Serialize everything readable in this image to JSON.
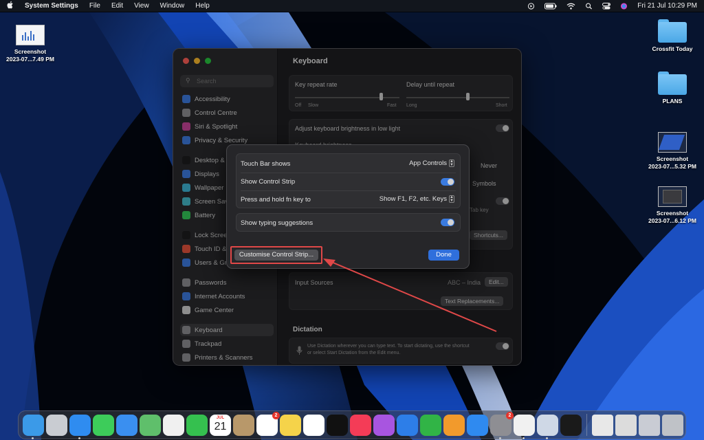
{
  "menubar": {
    "apple_icon": "apple-logo-icon",
    "app_name": "System Settings",
    "menus": [
      "File",
      "Edit",
      "View",
      "Window",
      "Help"
    ],
    "status_icons": [
      "screen-record-icon",
      "battery-icon",
      "wifi-icon",
      "spotlight-search-icon",
      "control-centre-icon",
      "siri-icon"
    ],
    "clock": "Fri 21 Jul  10:29 PM"
  },
  "desktop": {
    "items": [
      {
        "name": "Screenshot",
        "sub": "2023-07...7.49 PM",
        "type": "screenshot"
      },
      {
        "name": "Crossfit Today",
        "sub": "",
        "type": "folder"
      },
      {
        "name": "PLANS",
        "sub": "",
        "type": "folder"
      },
      {
        "name": "Screenshot",
        "sub": "2023-07...5.32 PM",
        "type": "screenshot"
      },
      {
        "name": "Screenshot",
        "sub": "2023-07...6.12 PM",
        "type": "screenshot"
      }
    ]
  },
  "window": {
    "search_placeholder": "Search",
    "sidebar": [
      {
        "label": "Accessibility",
        "color": "#3d7be0"
      },
      {
        "label": "Control Centre",
        "color": "#8e8e93"
      },
      {
        "label": "Siri & Spotlight",
        "color": "#c8459a"
      },
      {
        "label": "Privacy & Security",
        "color": "#3d7be0"
      },
      {
        "label": "Desktop & Dock",
        "color": "#1c1c1e"
      },
      {
        "label": "Displays",
        "color": "#3d7be0"
      },
      {
        "label": "Wallpaper",
        "color": "#3fb4d4"
      },
      {
        "label": "Screen Saver",
        "color": "#45b8c9"
      },
      {
        "label": "Battery",
        "color": "#34c759"
      },
      {
        "label": "Lock Screen",
        "color": "#1c1c1e"
      },
      {
        "label": "Touch ID & Password",
        "color": "#e5533d"
      },
      {
        "label": "Users & Groups",
        "color": "#3d7be0"
      },
      {
        "label": "Passwords",
        "color": "#8e8e93"
      },
      {
        "label": "Internet Accounts",
        "color": "#3d7be0"
      },
      {
        "label": "Game Center",
        "color": "#d0d0d0"
      },
      {
        "label": "Keyboard",
        "color": "#8e8e93"
      },
      {
        "label": "Trackpad",
        "color": "#8e8e93"
      },
      {
        "label": "Printers & Scanners",
        "color": "#8e8e93"
      }
    ],
    "title": "Keyboard",
    "key_repeat_rate_label": "Key repeat rate",
    "key_repeat_left": "Off",
    "key_repeat_slow": "Slow",
    "key_repeat_fast": "Fast",
    "delay_label": "Delay until repeat",
    "delay_long": "Long",
    "delay_short": "Short",
    "brightness_label": "Adjust keyboard brightness in low light",
    "brightness_label_partial": "Keyboard brightness",
    "never_value": "Never",
    "symbols_value": "Symbols",
    "tab_key_partial": "Tab key",
    "shortcuts_btn": "Shortcuts...",
    "input_sources_label": "Input Sources",
    "input_sources_value": "ABC – India",
    "edit_btn": "Edit...",
    "text_replacements_btn": "Text Replacements...",
    "dictation_title": "Dictation",
    "dictation_desc_1": "Use Dictation wherever you can type text. To start dictating, use the shortcut",
    "dictation_desc_2": "or select Start Dictation from the Edit menu.",
    "dictation_on": false
  },
  "sheet": {
    "touch_bar_label": "Touch Bar shows",
    "touch_bar_value": "App Controls",
    "control_strip_label": "Show Control Strip",
    "control_strip_on": true,
    "fn_key_label": "Press and hold fn key to",
    "fn_key_value": "Show F1, F2, etc. Keys",
    "typing_label": "Show typing suggestions",
    "typing_on": true,
    "customise_btn": "Customise Control Strip...",
    "done_btn": "Done"
  },
  "annotation": {
    "color": "#e04848"
  },
  "dock": {
    "apps": [
      {
        "name": "finder-icon",
        "color": "#3b9ae8",
        "running": true
      },
      {
        "name": "launchpad-icon",
        "color": "#c9ccd2",
        "running": false
      },
      {
        "name": "safari-icon",
        "color": "#2f8cf0",
        "running": true
      },
      {
        "name": "messages-icon",
        "color": "#3dcc5a",
        "running": false
      },
      {
        "name": "mail-icon",
        "color": "#3a8ff0",
        "running": false
      },
      {
        "name": "maps-icon",
        "color": "#5fbf6b",
        "running": false
      },
      {
        "name": "photos-icon",
        "color": "#f0f0f0",
        "running": false
      },
      {
        "name": "facetime-icon",
        "color": "#35c04f",
        "running": false
      },
      {
        "name": "calendar-icon",
        "color": "#ffffff",
        "running": false,
        "month": "JUL",
        "day": "21"
      },
      {
        "name": "contacts-icon",
        "color": "#b8986a",
        "running": false
      },
      {
        "name": "reminders-icon",
        "color": "#ffffff",
        "running": false,
        "badge": "2"
      },
      {
        "name": "notes-icon",
        "color": "#f5d34a",
        "running": false
      },
      {
        "name": "freeform-icon",
        "color": "#ffffff",
        "running": false
      },
      {
        "name": "apple-tv-icon",
        "color": "#111111",
        "running": false
      },
      {
        "name": "music-icon",
        "color": "#f43c57",
        "running": false
      },
      {
        "name": "podcasts-icon",
        "color": "#a855e0",
        "running": false
      },
      {
        "name": "keynote-icon",
        "color": "#2d7ee8",
        "running": false
      },
      {
        "name": "numbers-icon",
        "color": "#31b446",
        "running": false
      },
      {
        "name": "pages-icon",
        "color": "#f29a2c",
        "running": false
      },
      {
        "name": "app-store-icon",
        "color": "#2f8af0",
        "running": false
      },
      {
        "name": "system-settings-icon",
        "color": "#8e8e93",
        "running": true,
        "badge": "2"
      },
      {
        "name": "chrome-icon",
        "color": "#f1f1f1",
        "running": true
      },
      {
        "name": "preview-icon",
        "color": "#cfd8e6",
        "running": true
      },
      {
        "name": "voice-memos-icon",
        "color": "#1a1a1a",
        "running": false
      }
    ],
    "right": [
      {
        "name": "document-thumbnail-icon",
        "color": "#e8e8e8"
      },
      {
        "name": "screenshots-stack-icon",
        "color": "#dcdcdc"
      },
      {
        "name": "screenshot-stack-icon-2",
        "color": "#c9ccd4"
      },
      {
        "name": "trash-icon",
        "color": "#bfc2c7"
      }
    ]
  }
}
